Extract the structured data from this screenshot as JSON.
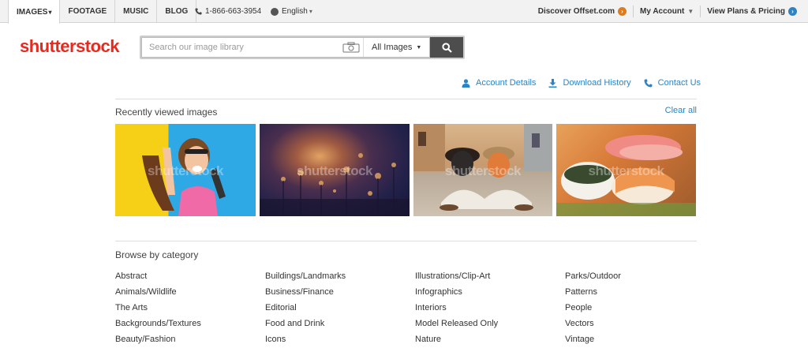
{
  "topnav": {
    "tabs": [
      {
        "label": "IMAGES",
        "caret": "▾"
      },
      {
        "label": "FOOTAGE"
      },
      {
        "label": "MUSIC"
      },
      {
        "label": "BLOG"
      }
    ],
    "phone": "1-866-663-3954",
    "language": "English",
    "right": {
      "offset": "Discover Offset.com",
      "account": "My Account",
      "plans": "View Plans & Pricing"
    }
  },
  "header": {
    "logo": "shutterstock",
    "search_placeholder": "Search our image library",
    "image_type": "All Images"
  },
  "account_links": {
    "details": "Account Details",
    "history": "Download History",
    "contact": "Contact Us"
  },
  "recent": {
    "title": "Recently viewed images",
    "clear": "Clear all",
    "watermark": "shutterstock"
  },
  "browse": {
    "title": "Browse by category",
    "columns": [
      [
        "Abstract",
        "Animals/Wildlife",
        "The Arts",
        "Backgrounds/Textures",
        "Beauty/Fashion"
      ],
      [
        "Buildings/Landmarks",
        "Business/Finance",
        "Editorial",
        "Food and Drink",
        "Icons"
      ],
      [
        "Illustrations/Clip-Art",
        "Infographics",
        "Interiors",
        "Model Released Only",
        "Nature"
      ],
      [
        "Parks/Outdoor",
        "Patterns",
        "People",
        "Vectors",
        "Vintage"
      ]
    ]
  },
  "colors": {
    "brand": "#e62a1f",
    "link": "#2a84c6",
    "offset_arrow": "#e07b1a"
  }
}
